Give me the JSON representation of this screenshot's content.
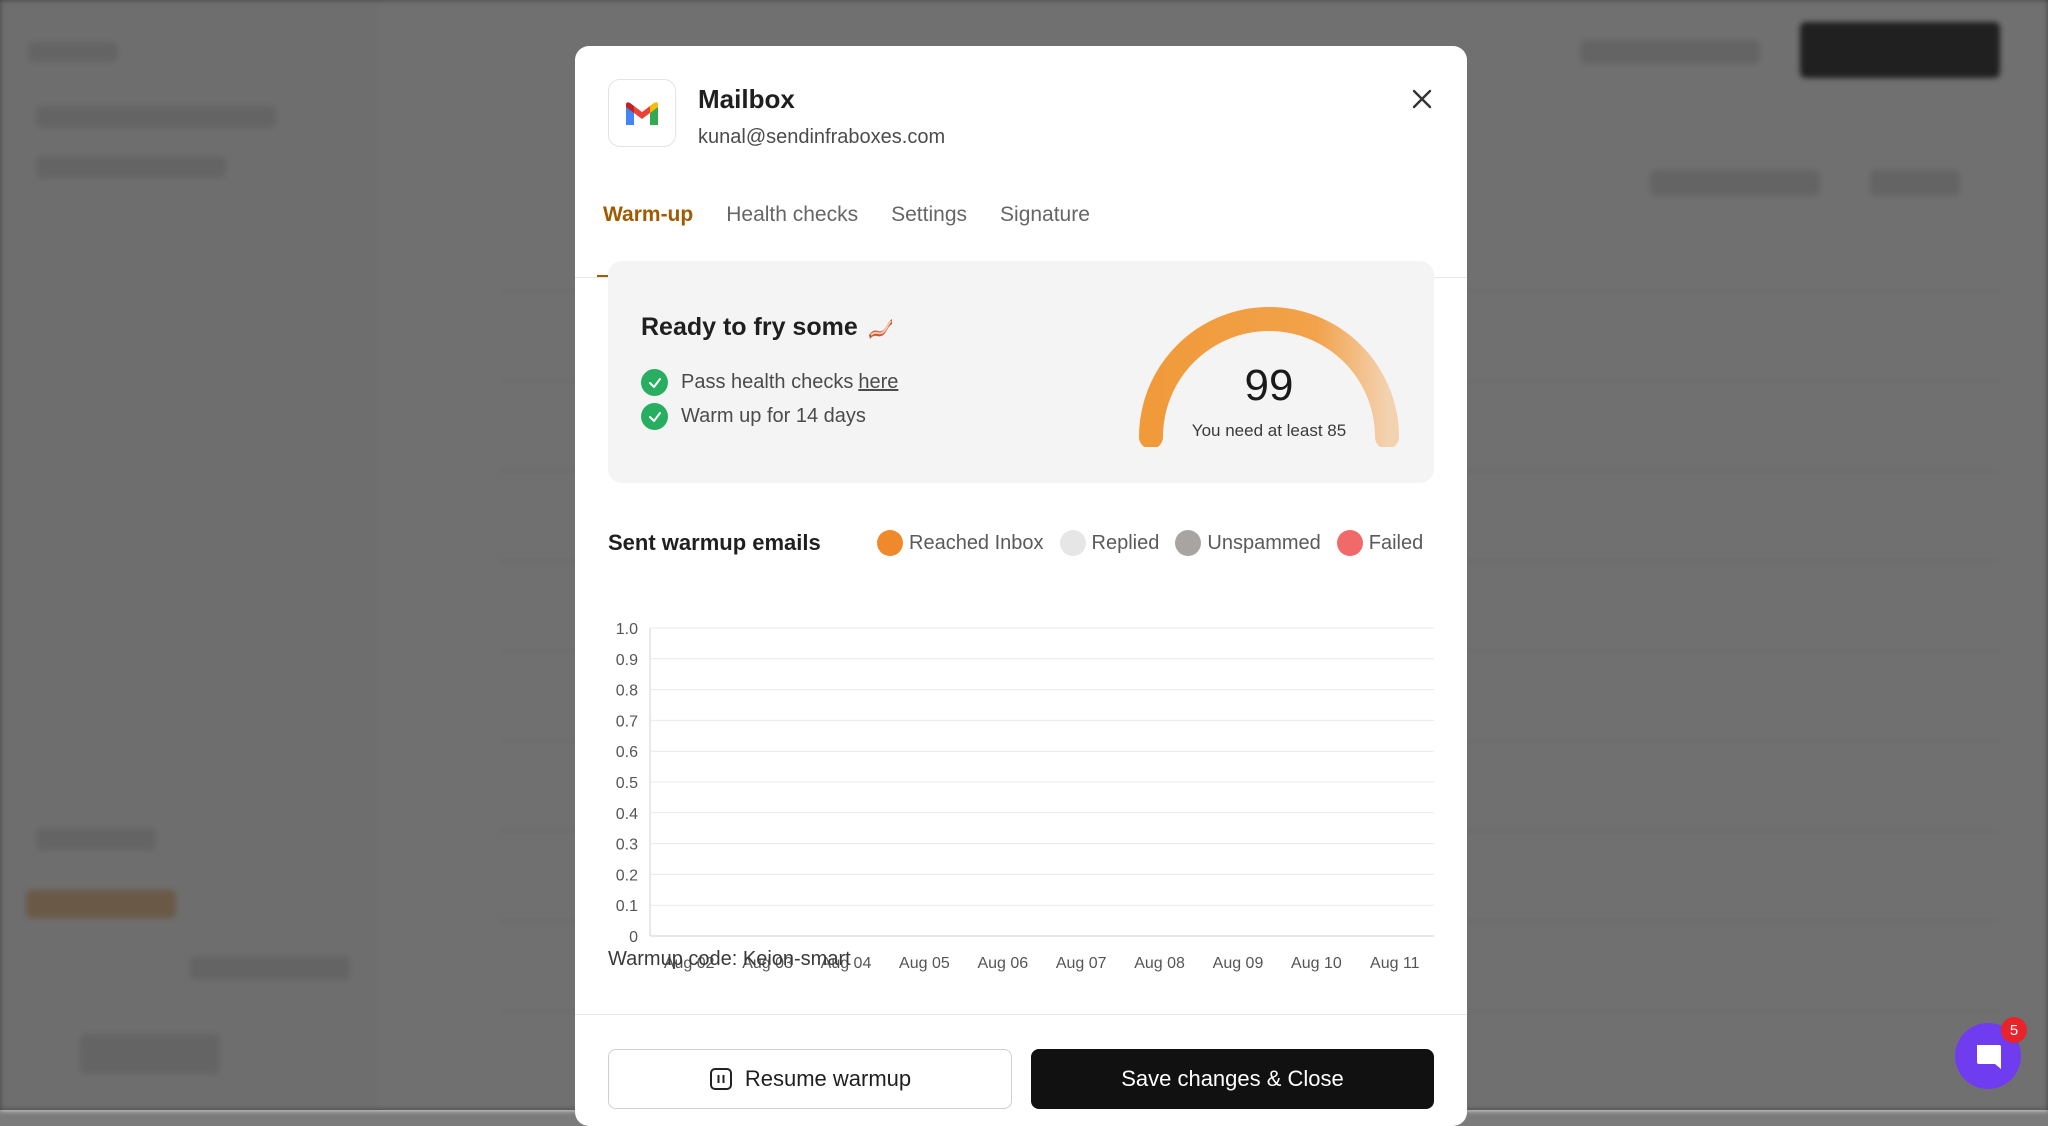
{
  "mailbox": {
    "title": "Mailbox",
    "email": "kunal@sendinfraboxes.com"
  },
  "tabs": [
    {
      "label": "Warm-up",
      "active": true
    },
    {
      "label": "Health checks",
      "active": false
    },
    {
      "label": "Settings",
      "active": false
    },
    {
      "label": "Signature",
      "active": false
    }
  ],
  "ready": {
    "title": "Ready to fry some",
    "checks": [
      {
        "text": "Pass health checks",
        "link": "here"
      },
      {
        "text": "Warm up for 14 days"
      }
    ],
    "score": "99",
    "caption": "You need at least 85"
  },
  "chart_section": {
    "title": "Sent warmup emails",
    "warmup_code": "Warmup code: Keion-smart"
  },
  "chart_data": {
    "type": "bar",
    "categories": [
      "Aug 02",
      "Aug 03",
      "Aug 04",
      "Aug 05",
      "Aug 06",
      "Aug 07",
      "Aug 08",
      "Aug 09",
      "Aug 10",
      "Aug 11"
    ],
    "series": [
      {
        "name": "Reached Inbox",
        "color": "#f0892b",
        "values": [
          0,
          0,
          0,
          0,
          0,
          0,
          0,
          0,
          0,
          0
        ]
      },
      {
        "name": "Replied",
        "color": "#e6e6e6",
        "values": [
          0,
          0,
          0,
          0,
          0,
          0,
          0,
          0,
          0,
          0
        ]
      },
      {
        "name": "Unspammed",
        "color": "#a8a4a1",
        "values": [
          0,
          0,
          0,
          0,
          0,
          0,
          0,
          0,
          0,
          0
        ]
      },
      {
        "name": "Failed",
        "color": "#f06a6a",
        "values": [
          0,
          0,
          0,
          0,
          0,
          0,
          0,
          0,
          0,
          0
        ]
      }
    ],
    "yticks": [
      "0",
      "0.1",
      "0.2",
      "0.3",
      "0.4",
      "0.5",
      "0.6",
      "0.7",
      "0.8",
      "0.9",
      "1.0"
    ],
    "ylim": [
      0,
      1
    ],
    "grid": true,
    "legend": "top-right"
  },
  "buttons": {
    "resume": "Resume warmup",
    "save": "Save changes & Close"
  },
  "chat": {
    "badge": "5"
  },
  "colors": {
    "accent": "#a05a00",
    "gauge": "#f0a040",
    "success": "#27ae60",
    "primary_button": "#111111",
    "chat": "#6f3cf0"
  }
}
